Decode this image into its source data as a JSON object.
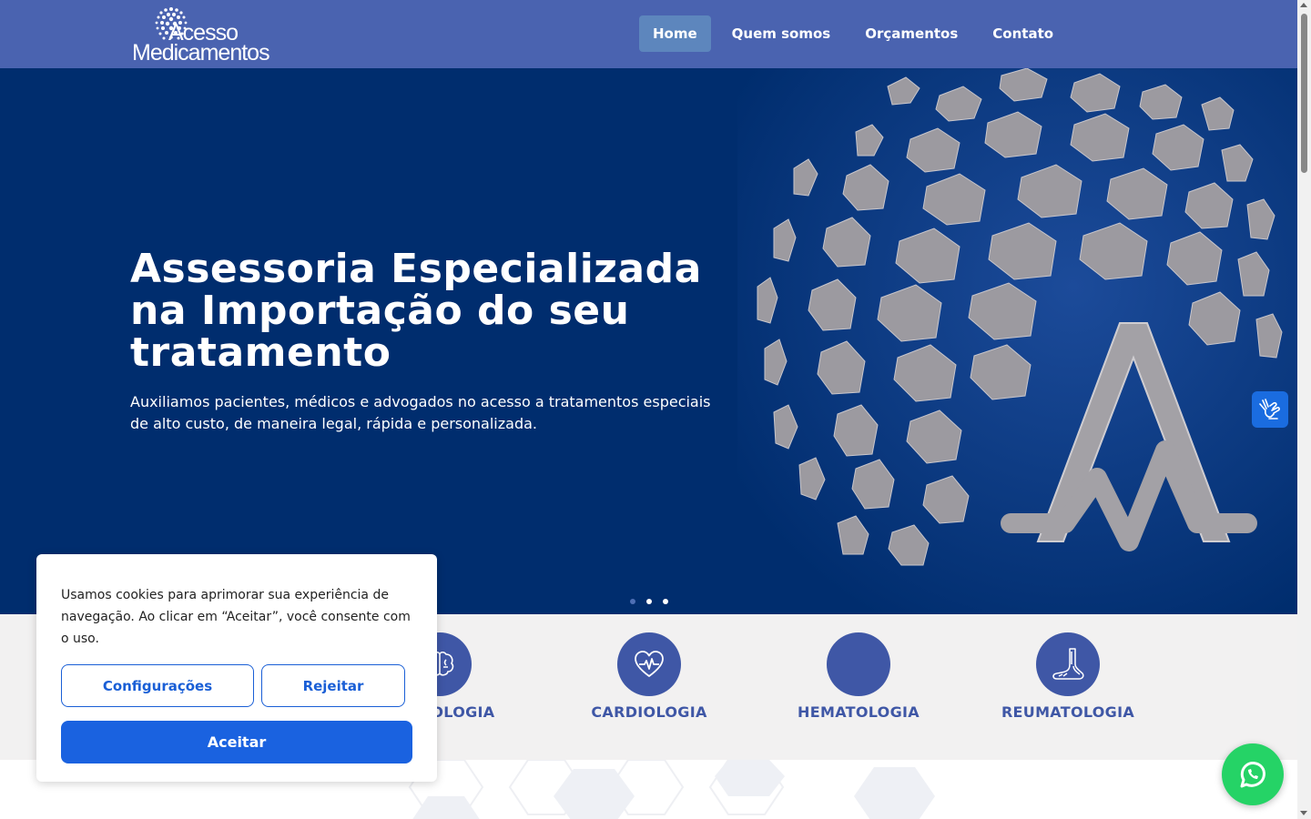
{
  "header": {
    "logo": {
      "line1": "Acesso",
      "line2": "Medicamentos"
    },
    "nav": [
      {
        "label": "Home",
        "active": true
      },
      {
        "label": "Quem somos",
        "active": false
      },
      {
        "label": "Orçamentos",
        "active": false
      },
      {
        "label": "Contato",
        "active": false
      }
    ]
  },
  "hero": {
    "title": "Assessoria Especializada na Importação do seu tratamento",
    "subtitle": "Auxiliamos pacientes, médicos e advogados no acesso a tratamentos especiais de alto custo, de maneira legal, rápida e personalizada.",
    "slides": 3,
    "active_slide": 0
  },
  "specialties": [
    {
      "label": "NEUROLOGIA",
      "icon": "brain-icon"
    },
    {
      "label": "CARDIOLOGIA",
      "icon": "heart-pulse-icon"
    },
    {
      "label": "HEMATOLOGIA",
      "icon": "blood-drop-icon"
    },
    {
      "label": "REUMATOLOGIA",
      "icon": "foot-bones-icon"
    }
  ],
  "cookie": {
    "text": "Usamos cookies para aprimorar sua experiência de navegação. Ao clicar em “Aceitar”, você consente com o uso.",
    "settings_label": "Configurações",
    "reject_label": "Rejeitar",
    "accept_label": "Aceitar"
  },
  "widgets": {
    "accessibility_icon": "sign-language-hands-icon",
    "whatsapp_icon": "whatsapp-icon"
  },
  "colors": {
    "header_bg": "#4a63b0",
    "hero_bg": "#002d6e",
    "accent": "#3f57a6",
    "button_blue": "#1a62e0",
    "whatsapp_green": "#25d366"
  }
}
